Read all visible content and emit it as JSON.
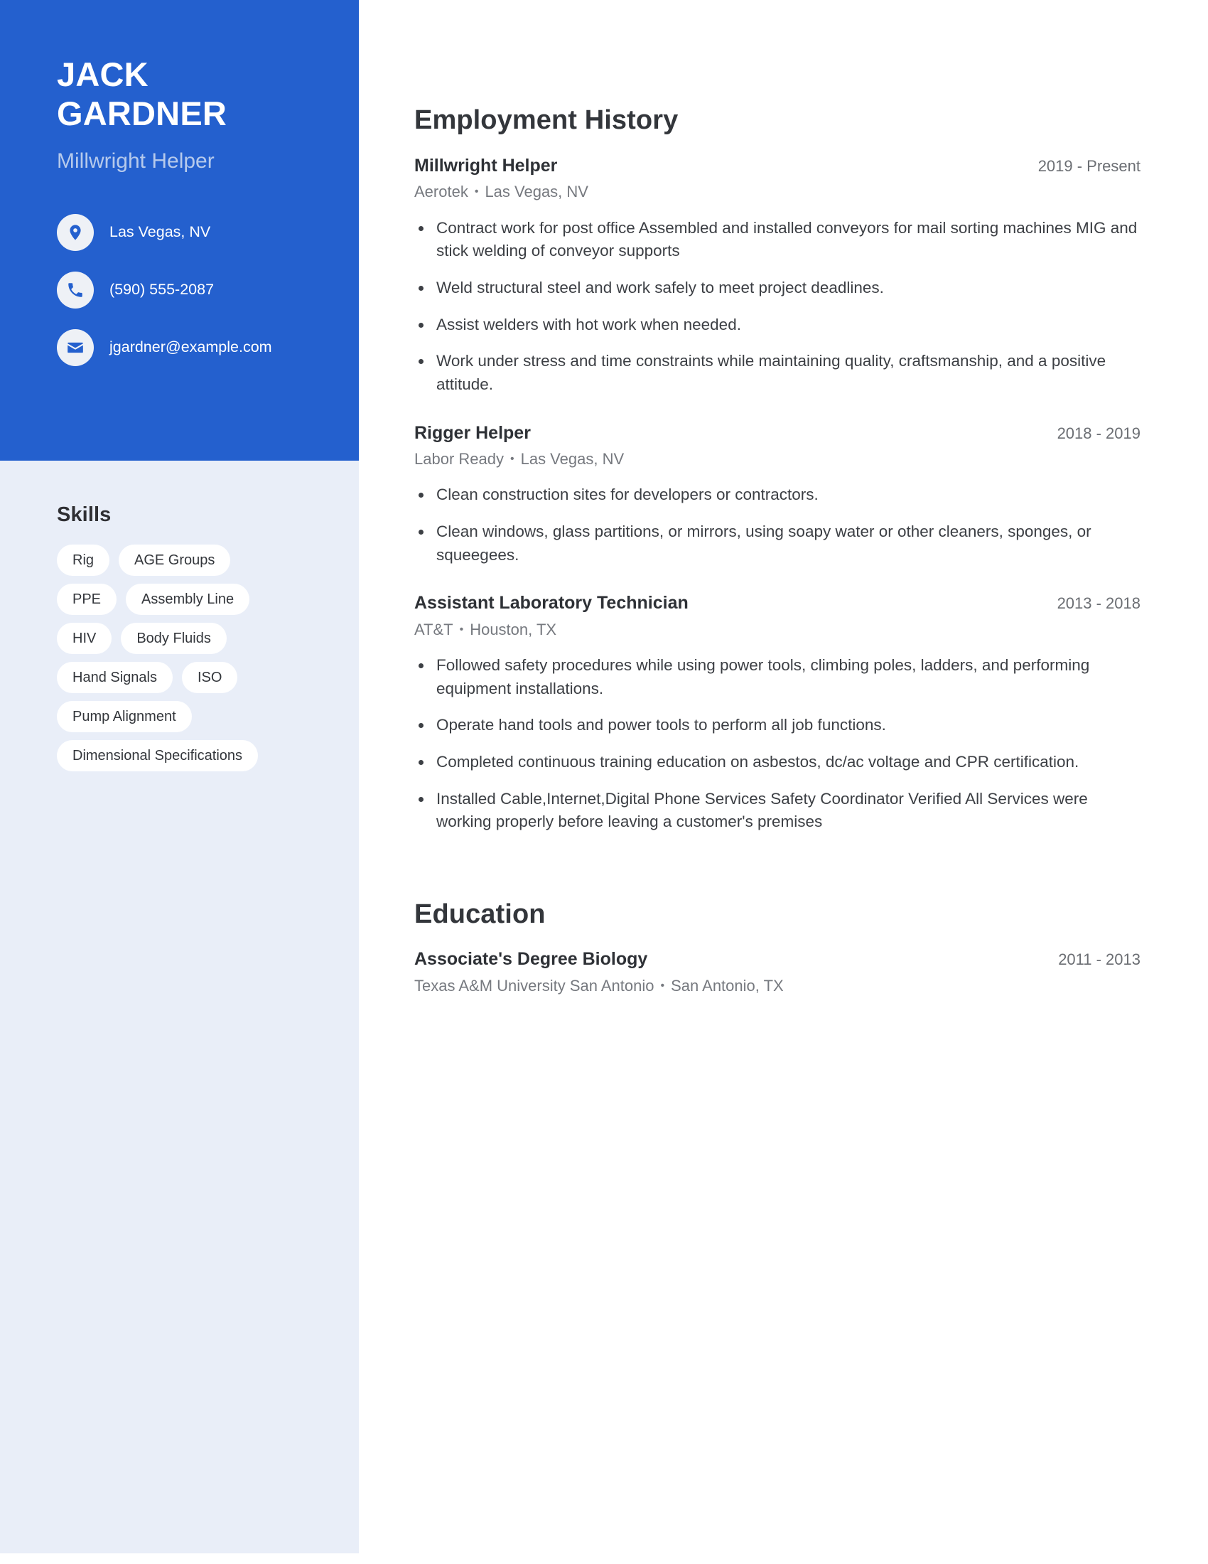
{
  "profile": {
    "first_name": "JACK",
    "last_name": "GARDNER",
    "title": "Millwright Helper",
    "accent_color": "#2460ce",
    "sidebar_color": "#e9eef8"
  },
  "contacts": [
    {
      "icon": "map-pin-icon",
      "value": "Las Vegas, NV"
    },
    {
      "icon": "phone-icon",
      "value": "(590) 555-2087"
    },
    {
      "icon": "envelope-icon",
      "value": "jgardner@example.com"
    }
  ],
  "skills": {
    "heading": "Skills",
    "items": [
      "Rig",
      "AGE Groups",
      "PPE",
      "Assembly Line",
      "HIV",
      "Body Fluids",
      "Hand Signals",
      "ISO",
      "Pump Alignment",
      "Dimensional Specifications"
    ]
  },
  "employment": {
    "heading": "Employment History",
    "entries": [
      {
        "role": "Millwright Helper",
        "dates": "2019 - Present",
        "company": "Aerotek",
        "location": "Las Vegas, NV",
        "bullets": [
          "Contract work for post office Assembled and installed conveyors for mail sorting machines MIG and stick welding of conveyor supports",
          "Weld structural steel and work safely to meet project deadlines.",
          "Assist welders with hot work when needed.",
          "Work under stress and time constraints while maintaining quality, craftsmanship, and a positive attitude."
        ]
      },
      {
        "role": "Rigger Helper",
        "dates": "2018 - 2019",
        "company": "Labor Ready",
        "location": "Las Vegas, NV",
        "bullets": [
          "Clean construction sites for developers or contractors.",
          "Clean windows, glass partitions, or mirrors, using soapy water or other cleaners, sponges, or squeegees."
        ]
      },
      {
        "role": "Assistant Laboratory Technician",
        "dates": "2013 - 2018",
        "company": "AT&T",
        "location": "Houston, TX",
        "bullets": [
          "Followed safety procedures while using power tools, climbing poles, ladders, and performing equipment installations.",
          "Operate hand tools and power tools to perform all job functions.",
          "Completed continuous training education on asbestos, dc/ac voltage and CPR certification.",
          "Installed Cable,Internet,Digital Phone Services Safety Coordinator Verified All Services were working properly before leaving a customer's premises"
        ]
      }
    ]
  },
  "education": {
    "heading": "Education",
    "entries": [
      {
        "degree": "Associate's Degree Biology",
        "dates": "2011 - 2013",
        "school": "Texas A&M University San Antonio",
        "location": "San Antonio, TX"
      }
    ]
  },
  "separator": "•"
}
